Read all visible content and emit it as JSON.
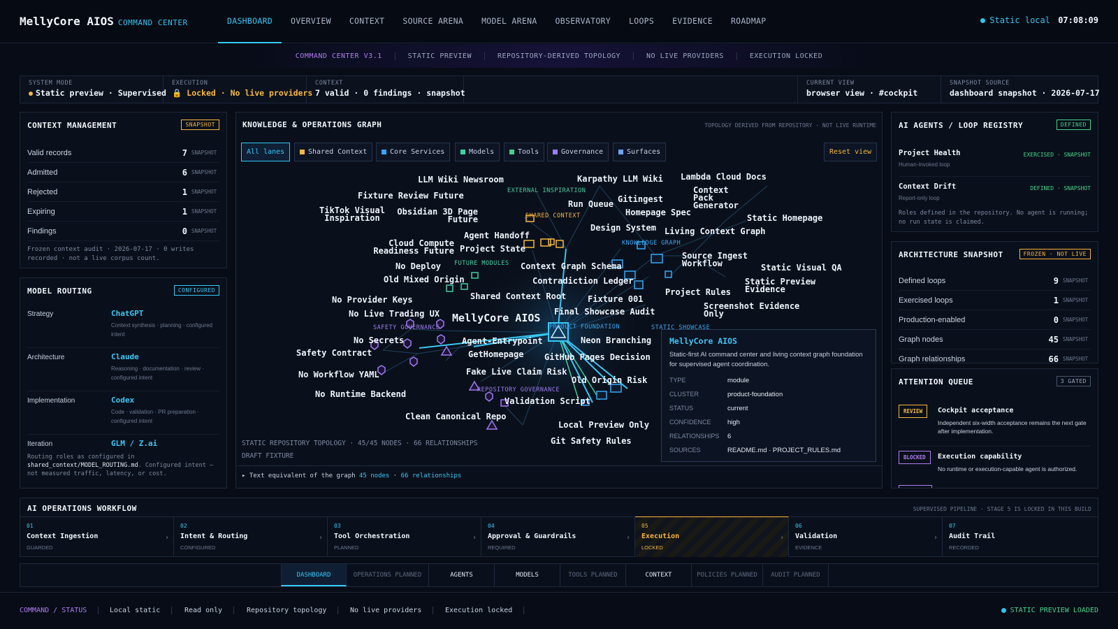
{
  "header": {
    "logo": "MellyCore AIOS",
    "logo_sub": "COMMAND CENTER",
    "nav": [
      "DASHBOARD",
      "OVERVIEW",
      "CONTEXT",
      "SOURCE ARENA",
      "MODEL ARENA",
      "OBSERVATORY",
      "LOOPS",
      "EVIDENCE",
      "ROADMAP"
    ],
    "clock_label": "Static local",
    "clock_time": "07:08:09"
  },
  "banner": [
    "COMMAND CENTER V3.1",
    "STATIC PREVIEW",
    "REPOSITORY-DERIVED TOPOLOGY",
    "NO LIVE PROVIDERS",
    "EXECUTION LOCKED"
  ],
  "status": {
    "mode_label": "SYSTEM MODE",
    "mode_value": "Static preview · Supervised",
    "exec_label": "EXECUTION",
    "exec_locked": "Locked",
    "exec_nolive": "No live providers",
    "ctx_label": "CONTEXT",
    "ctx_value": "7 valid · 0 findings · snapshot",
    "view_label": "CURRENT VIEW",
    "view_value": "browser view · #cockpit",
    "snap_label": "SNAPSHOT SOURCE",
    "snap_value": "dashboard snapshot · 2026-07-17"
  },
  "context_mgmt": {
    "title": "CONTEXT MANAGEMENT",
    "tag": "SNAPSHOT",
    "rows": [
      {
        "label": "Valid records",
        "value": "7",
        "note": "SNAPSHOT"
      },
      {
        "label": "Admitted",
        "value": "6",
        "note": "SNAPSHOT"
      },
      {
        "label": "Rejected",
        "value": "1",
        "note": "SNAPSHOT"
      },
      {
        "label": "Expiring",
        "value": "1",
        "note": "SNAPSHOT"
      },
      {
        "label": "Findings",
        "value": "0",
        "note": "SNAPSHOT"
      }
    ],
    "footer": "Frozen context audit · 2026-07-17 · 0 writes recorded · not a live corpus count."
  },
  "model_routing": {
    "title": "MODEL ROUTING",
    "tag": "CONFIGURED",
    "rows": [
      {
        "label": "Strategy",
        "model": "ChatGPT",
        "desc": "Context synthesis · planning · configured intent"
      },
      {
        "label": "Architecture",
        "model": "Claude",
        "desc": "Reasoning · documentation · review · configured intent"
      },
      {
        "label": "Implementation",
        "model": "Codex",
        "desc": "Code · validation · PR preparation · configured intent"
      },
      {
        "label": "Iteration",
        "model": "GLM / Z.ai",
        "desc": ""
      }
    ],
    "footer_a": "Routing roles as configured in",
    "footer_b": "shared_context/MODEL_ROUTING.md",
    "footer_c": ". Configured intent — not measured traffic, latency, or cost."
  },
  "graph": {
    "title": "KNOWLEDGE & OPERATIONS GRAPH",
    "subtitle": "TOPOLOGY DERIVED FROM REPOSITORY · NOT LIVE RUNTIME",
    "filters": [
      "All lanes",
      "Shared Context",
      "Core Services",
      "Models",
      "Tools",
      "Governance",
      "Surfaces"
    ],
    "filter_colors": [
      "#36c8f6",
      "#f5b73d",
      "#36a9f6",
      "#3fd0a0",
      "#44d38a",
      "#a07cf0",
      "#6aa6f0"
    ],
    "reset": "Reset view",
    "clusters": [
      "EXTERNAL INSPIRATION",
      "SHARED CONTEXT",
      "KNOWLEDGE GRAPH",
      "FUTURE MODULES",
      "SAFETY GOVERNANCE",
      "PRODUCT FOUNDATION",
      "STATIC SHOWCASE",
      "REPOSITORY GOVERNANCE"
    ],
    "nodes": [
      "LLM Wiki Newsroom",
      "Karpathy LLM Wiki",
      "Lambda Cloud Docs",
      "Fixture Review Future",
      "Context Pack Generator",
      "Run Queue",
      "Gitingest",
      "TikTok Visual Inspiration",
      "Obsidian 3D Page Future",
      "Homepage Spec",
      "Static Homepage",
      "Design System",
      "Living Context Graph",
      "Agent Handoff",
      "Cloud Compute Readiness Future",
      "Project State",
      "Source Ingest Workflow",
      "No Deploy",
      "Context Graph Schema",
      "Static Visual QA",
      "Old Mixed Origin",
      "Contradiction Ledger",
      "Static Preview Evidence",
      "Project Rules",
      "No Provider Keys",
      "Fixture 001",
      "Shared Context Root",
      "Screenshot Evidence Only",
      "No Live Trading UX",
      "Final Showcase Audit",
      "MellyCore AIOS",
      "No Secrets",
      "Agent-Entrypoint",
      "Neon Branching",
      "Safety Contract",
      "GetHomepage",
      "GitHub Pages Decision",
      "No Workflow YAML",
      "Fake Live Claim Risk",
      "Old Origin Risk",
      "No Runtime Backend",
      "Validation Script",
      "Clean Canonical Repo",
      "Local Preview Only",
      "Git Safety Rules"
    ],
    "footer1": "STATIC REPOSITORY TOPOLOGY · 45/45 NODES · 66 RELATIONSHIPS",
    "footer2": "DRAFT FIXTURE",
    "text_eq": "Text equivalent of the graph",
    "text_nodes": "45 nodes",
    "text_rel": "66 relationships"
  },
  "tooltip": {
    "title": "MellyCore AIOS",
    "desc": "Static-first AI command center and living context graph foundation for supervised agent coordination.",
    "fields": [
      {
        "k": "TYPE",
        "v": "module"
      },
      {
        "k": "CLUSTER",
        "v": "product-foundation"
      },
      {
        "k": "STATUS",
        "v": "current"
      },
      {
        "k": "CONFIDENCE",
        "v": "high"
      },
      {
        "k": "RELATIONSHIPS",
        "v": "6"
      },
      {
        "k": "SOURCES",
        "v": "README.md · PROJECT_RULES.md"
      }
    ]
  },
  "agents": {
    "title": "AI AGENTS / LOOP REGISTRY",
    "tag": "DEFINED",
    "items": [
      {
        "name": "Project Health",
        "sub": "Human-invoked loop",
        "badge": "EXERCISED · SNAPSHOT"
      },
      {
        "name": "Context Drift",
        "sub": "Report-only loop",
        "badge": "DEFINED · SNAPSHOT"
      }
    ],
    "note": "Roles defined in the repository. No agent is running; no run state is claimed."
  },
  "arch": {
    "title": "ARCHITECTURE SNAPSHOT",
    "tag": "FROZEN · NOT LIVE",
    "rows": [
      {
        "label": "Defined loops",
        "value": "9",
        "note": "SNAPSHOT"
      },
      {
        "label": "Exercised loops",
        "value": "1",
        "note": "SNAPSHOT"
      },
      {
        "label": "Production-enabled",
        "value": "0",
        "note": "SNAPSHOT"
      },
      {
        "label": "Graph nodes",
        "value": "45",
        "note": "SNAPSHOT"
      },
      {
        "label": "Graph relationships",
        "value": "66",
        "note": "SNAPSHOT"
      }
    ]
  },
  "attention": {
    "title": "ATTENTION QUEUE",
    "tag": "3 GATED",
    "items": [
      {
        "badge": "REVIEW",
        "title": "Cockpit acceptance",
        "desc": "Independent six-width acceptance remains the next gate after implementation."
      },
      {
        "badge": "BLOCKED",
        "title": "Execution capability",
        "desc": "No runtime or execution-capable agent is authorized."
      }
    ]
  },
  "workflow": {
    "title": "AI OPERATIONS WORKFLOW",
    "subtitle": "SUPERVISED PIPELINE · STAGE 5 IS LOCKED IN THIS BUILD",
    "stages": [
      {
        "num": "01",
        "title": "Context Ingestion",
        "state": "GUARDED"
      },
      {
        "num": "02",
        "title": "Intent & Routing",
        "state": "CONFIGURED"
      },
      {
        "num": "03",
        "title": "Tool Orchestration",
        "state": "PLANNED"
      },
      {
        "num": "04",
        "title": "Approval & Guardrails",
        "state": "REQUIRED"
      },
      {
        "num": "05",
        "title": "Execution",
        "state": "LOCKED"
      },
      {
        "num": "06",
        "title": "Validation",
        "state": "EVIDENCE"
      },
      {
        "num": "07",
        "title": "Audit Trail",
        "state": "RECORDED"
      }
    ]
  },
  "tabs": [
    "DASHBOARD",
    "OPERATIONS PLANNED",
    "AGENTS",
    "MODELS",
    "TOOLS PLANNED",
    "CONTEXT",
    "POLICIES PLANNED",
    "AUDIT PLANNED"
  ],
  "footer": {
    "cmd": "COMMAND / STATUS",
    "items": [
      "Local static",
      "Read only",
      "Repository topology",
      "No live providers",
      "Execution locked"
    ],
    "loaded": "STATIC PREVIEW LOADED"
  }
}
